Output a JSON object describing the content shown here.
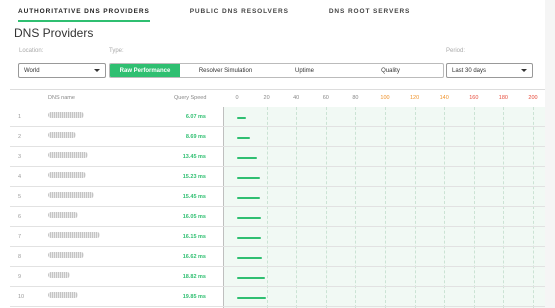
{
  "tabs": [
    {
      "label": "AUTHORITATIVE DNS PROVIDERS",
      "active": true
    },
    {
      "label": "PUBLIC DNS RESOLVERS",
      "active": false
    },
    {
      "label": "DNS ROOT SERVERS",
      "active": false
    }
  ],
  "title": "DNS Providers",
  "filters": {
    "location_label": "Location:",
    "location_value": "World",
    "type_label": "Type:",
    "type_options": [
      "Raw Performance",
      "Resolver Simulation",
      "Uptime",
      "Quality"
    ],
    "type_selected": "Raw Performance",
    "period_label": "Period:",
    "period_value": "Last 30 days"
  },
  "table": {
    "headers": {
      "name": "DNS name",
      "speed": "Query Speed"
    },
    "axis_ticks": [
      "0",
      "20",
      "40",
      "60",
      "80",
      "100",
      "120",
      "140",
      "160",
      "180",
      "200"
    ],
    "tick_colors": [
      "#888888",
      "#888888",
      "#888888",
      "#888888",
      "#888888",
      "#888888",
      "#f0932b",
      "#f0932b",
      "#f0932b",
      "#e74c3c",
      "#e74c3c",
      "#e74c3c"
    ],
    "rows": [
      {
        "rank": "1",
        "speed": "6.07 ms",
        "value": 6.07
      },
      {
        "rank": "2",
        "speed": "8.69 ms",
        "value": 8.69
      },
      {
        "rank": "3",
        "speed": "13.45 ms",
        "value": 13.45
      },
      {
        "rank": "4",
        "speed": "15.23 ms",
        "value": 15.23
      },
      {
        "rank": "5",
        "speed": "15.45 ms",
        "value": 15.45
      },
      {
        "rank": "6",
        "speed": "16.05 ms",
        "value": 16.05
      },
      {
        "rank": "7",
        "speed": "16.15 ms",
        "value": 16.15
      },
      {
        "rank": "8",
        "speed": "16.62 ms",
        "value": 16.62
      },
      {
        "rank": "9",
        "speed": "18.82 ms",
        "value": 18.82
      },
      {
        "rank": "10",
        "speed": "19.85 ms",
        "value": 19.85
      }
    ]
  },
  "colors": {
    "accent": "#2fbf71",
    "warn": "#f0932b",
    "bad": "#e74c3c"
  }
}
